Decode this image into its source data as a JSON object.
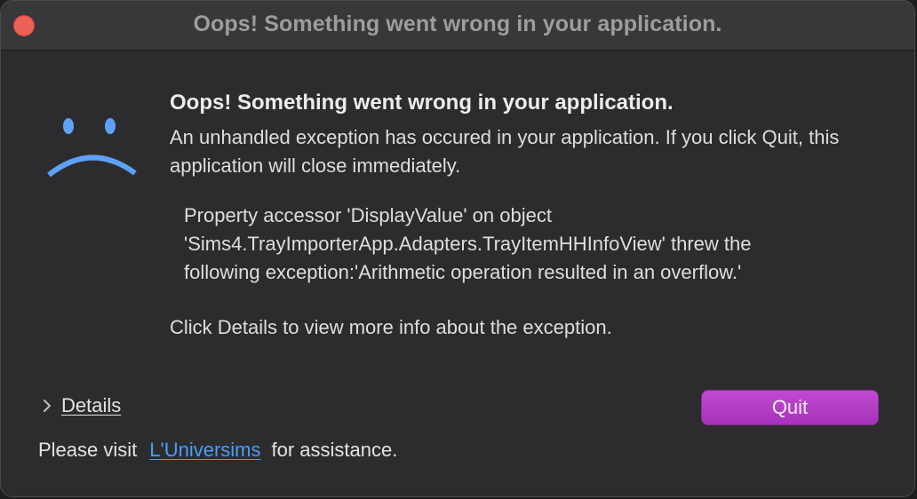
{
  "window": {
    "title": "Oops! Something went wrong in your application."
  },
  "dialog": {
    "icon": "sad-face-icon",
    "heading": "Oops! Something went wrong in your application.",
    "message": "An unhandled exception has occured in your application. If you click Quit, this application will close immediately.",
    "exception_lines": [
      "Property accessor 'DisplayValue' on object",
      "'Sims4.TrayImporterApp.Adapters.TrayItemHHInfoView' threw the",
      "following exception:'Arithmetic operation resulted in an overflow.'"
    ],
    "hint": "Click Details to view more info about the exception.",
    "details_label": "Details",
    "quit_label": "Quit"
  },
  "footer": {
    "prefix": "Please visit",
    "link_text": "L'Universims",
    "suffix": "for assistance."
  },
  "colors": {
    "close_button": "#ee5f57",
    "quit_button": "#b23fc4",
    "link": "#4a9ff5",
    "icon": "#5ea2f7"
  }
}
